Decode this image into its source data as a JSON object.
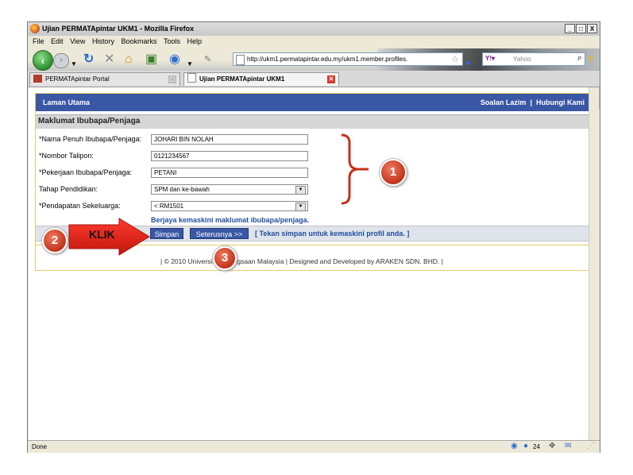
{
  "browser": {
    "title": "Ujian PERMATApintar UKM1 - Mozilla Firefox",
    "window_buttons": [
      "_",
      "□",
      "X"
    ],
    "menu": [
      "File",
      "Edit",
      "View",
      "History",
      "Bookmarks",
      "Tools",
      "Help"
    ],
    "url": "http://ukm1.permatapintar.edu.my/ukm1.member.profiles.",
    "search_engine": "Yahoo",
    "search_placeholder": "Yahoo",
    "tabs": [
      {
        "label": "PERMATApintar Portal",
        "active": false
      },
      {
        "label": "Ujian PERMATApintar UKM1",
        "active": true
      }
    ],
    "new_tab": "+",
    "status": "Done",
    "status_count": "24"
  },
  "page": {
    "nav_home": "Laman Utama",
    "nav_faq": "Soalan Lazim",
    "nav_sep": "|",
    "nav_contact": "Hubungi Kami",
    "section_title": "Maklumat Ibubapa/Penjaga",
    "form": {
      "name_label": "*Nama Penuh Ibubapa/Penjaga:",
      "name_value": "JOHARI BIN NOLAH",
      "phone_label": "*Nombor Talipon:",
      "phone_value": "0121234567",
      "job_label": "*Pekerjaan Ibubapa/Penjaga:",
      "job_value": "PETANI",
      "edu_label": "Tahap Pendidikan:",
      "edu_value": "SPM dan ke-bawah",
      "income_label": "*Pendapatan Sekeluarga:",
      "income_value": "< RM1501"
    },
    "success_message": "Berjaya kemaskini maklumat ibubapa/penjaga.",
    "save_button": "Simpan",
    "next_button": "Seterusnya >>",
    "hint": "[ Tekan simpan untuk kemaskini profil anda. ]",
    "footer": "| © 2010 Universiti Kebangsaan Malaysia | Designed and Developed by ARAKEN SDN. BHD. |"
  },
  "annotations": {
    "badge1": "1",
    "badge2": "2",
    "badge3": "3",
    "klik": "KLIK"
  },
  "colors": {
    "nav_blue": "#3957a4",
    "link_blue": "#1f4e9c",
    "annotation_red": "#d0321c",
    "page_border": "#e4cf67"
  }
}
